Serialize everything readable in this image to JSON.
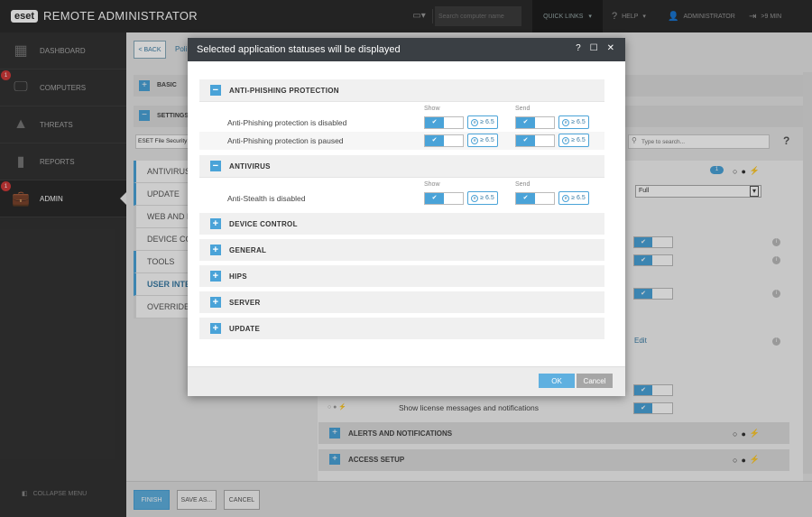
{
  "app": {
    "logo_badge": "eset",
    "title": "REMOTE ADMINISTRATOR"
  },
  "topbar": {
    "search_placeholder": "Search computer name",
    "quick_links": "QUICK LINKS",
    "help": "HELP",
    "user": "ADMINISTRATOR",
    "session": ">9 MIN"
  },
  "sidebar": {
    "items": [
      {
        "label": "DASHBOARD",
        "icon": "dashboard-icon"
      },
      {
        "label": "COMPUTERS",
        "icon": "computer-icon",
        "badge": "1"
      },
      {
        "label": "THREATS",
        "icon": "warning-icon"
      },
      {
        "label": "REPORTS",
        "icon": "reports-icon"
      },
      {
        "label": "ADMIN",
        "icon": "briefcase-icon",
        "badge": "1"
      }
    ],
    "collapse": "COLLAPSE MENU"
  },
  "background": {
    "back": "< BACK",
    "crumb": "Poli",
    "basic": "BASIC",
    "settings": "SETTINGS",
    "product_select": "ESET File Security",
    "search_placeholder": "Type to search...",
    "menu": [
      "ANTIVIRUS",
      "UPDATE",
      "WEB AND E",
      "DEVICE CON",
      "TOOLS",
      "USER INTE",
      "OVERRIDE M"
    ],
    "menu_selected": 5,
    "count_badge": "1",
    "full_select": "Full",
    "edit_link": "Edit",
    "license_label": "Show license messages and notifications",
    "alerts": "ALERTS AND NOTIFICATIONS",
    "access": "ACCESS SETUP"
  },
  "bottom": {
    "finish": "FINISH",
    "save_as": "SAVE AS...",
    "cancel": "CANCEL"
  },
  "modal": {
    "title": "Selected application statuses will be displayed",
    "ok": "OK",
    "cancel": "Cancel",
    "show_label": "Show",
    "send_label": "Send",
    "version": "≥ 6.5",
    "sections": [
      {
        "name": "ANTI-PHISHING PROTECTION",
        "expanded": true,
        "rows": [
          "Anti-Phishing protection is disabled",
          "Anti-Phishing protection is paused"
        ]
      },
      {
        "name": "ANTIVIRUS",
        "expanded": true,
        "rows": [
          "Anti-Stealth is disabled"
        ]
      },
      {
        "name": "DEVICE CONTROL",
        "expanded": false
      },
      {
        "name": "GENERAL",
        "expanded": false
      },
      {
        "name": "HIPS",
        "expanded": false
      },
      {
        "name": "SERVER",
        "expanded": false
      },
      {
        "name": "UPDATE",
        "expanded": false
      }
    ]
  }
}
